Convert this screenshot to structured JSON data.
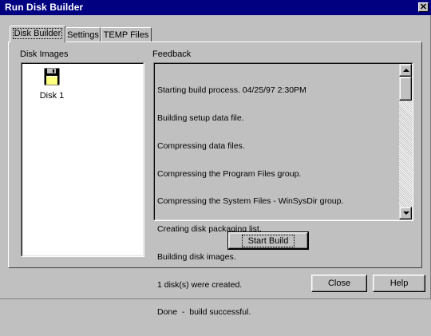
{
  "window": {
    "title": "Run Disk Builder",
    "close_glyph": "✕"
  },
  "tabs": [
    {
      "label": "Disk Builder",
      "active": true
    },
    {
      "label": "Settings",
      "active": false
    },
    {
      "label": "TEMP Files",
      "active": false
    }
  ],
  "disk_images": {
    "label": "Disk Images",
    "items": [
      {
        "label": "Disk 1",
        "icon": "floppy-disk-icon"
      }
    ]
  },
  "feedback": {
    "label": "Feedback",
    "lines": [
      "Starting build process. 04/25/97 2:30PM",
      "Building setup data file.",
      "Compressing data files.",
      "Compressing the Program Files group.",
      "Compressing the System Files - WinSysDir group.",
      "Creating disk packaging list.",
      "Building disk images.",
      "1 disk(s) were created.",
      "Done  -  build successful."
    ]
  },
  "buttons": {
    "start_build": "Start Build",
    "close": "Close",
    "help": "Help"
  },
  "colors": {
    "title_bar": "#000080",
    "face": "#c0c0c0",
    "floppy_label": "#ffff80"
  }
}
